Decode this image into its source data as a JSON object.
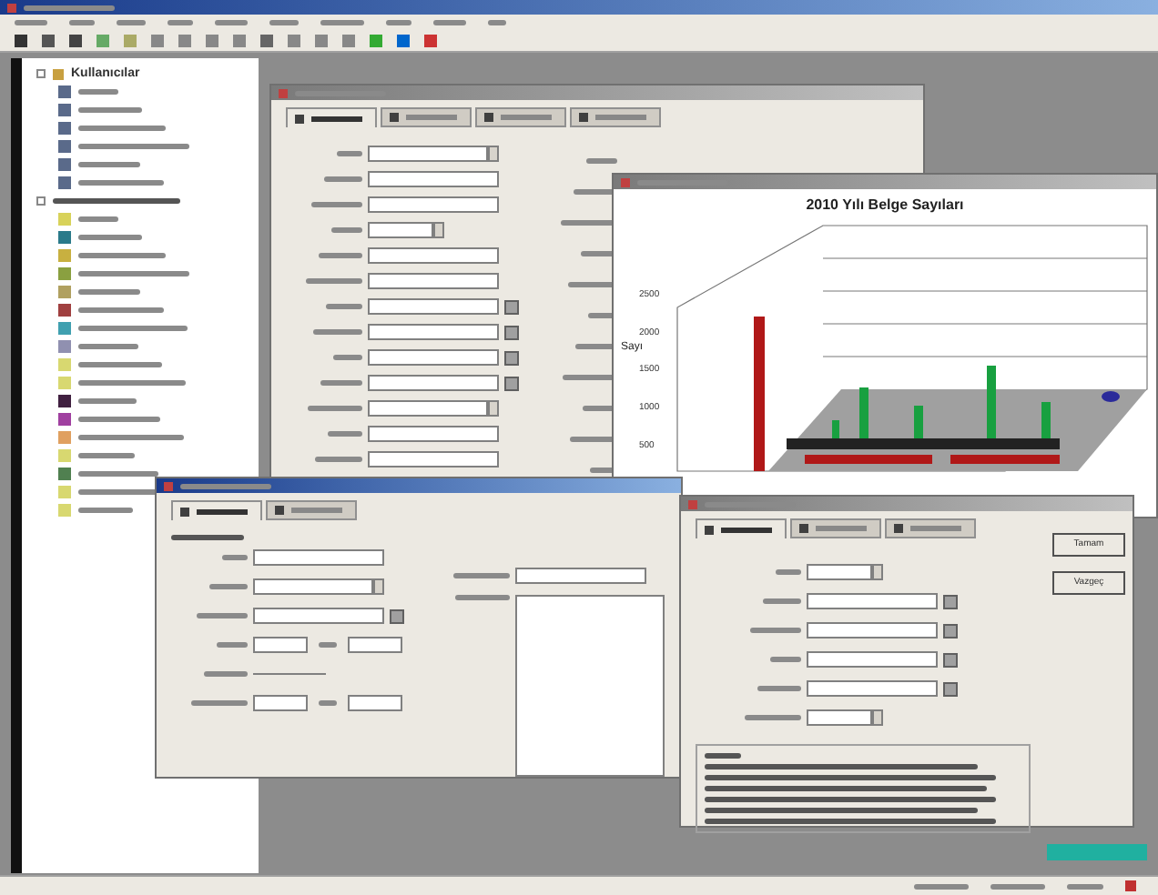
{
  "tree": {
    "heading": "Kullanıcılar",
    "groups": [
      {
        "items": [
          {
            "color": "#5a6a8a"
          },
          {
            "color": "#5a6a8a"
          },
          {
            "color": "#5a6a8a"
          },
          {
            "color": "#5a6a8a"
          },
          {
            "color": "#5a6a8a"
          },
          {
            "color": "#5a6a8a"
          }
        ]
      },
      {
        "items": [
          {
            "color": "#d8d25a"
          },
          {
            "color": "#2a7a8a"
          },
          {
            "color": "#c8b040"
          },
          {
            "color": "#8aa040"
          },
          {
            "color": "#b0a060"
          },
          {
            "color": "#a04040"
          },
          {
            "color": "#40a0b0"
          },
          {
            "color": "#9090b0"
          },
          {
            "color": "#d8d870"
          },
          {
            "color": "#d8d870"
          },
          {
            "color": "#402040"
          },
          {
            "color": "#a040a0"
          },
          {
            "color": "#e0a060"
          },
          {
            "color": "#d8d870"
          },
          {
            "color": "#508050"
          },
          {
            "color": "#d8d870"
          },
          {
            "color": "#d8d870"
          }
        ]
      }
    ]
  },
  "form_window": {
    "tabs": [
      {
        "selected": true
      },
      {
        "selected": false
      },
      {
        "selected": false
      },
      {
        "selected": false
      }
    ],
    "fields": [
      {
        "kind": "combo"
      },
      {
        "kind": "text"
      },
      {
        "kind": "text"
      },
      {
        "kind": "short"
      },
      {
        "kind": "text"
      },
      {
        "kind": "text"
      },
      {
        "kind": "pick"
      },
      {
        "kind": "pick"
      },
      {
        "kind": "pick"
      },
      {
        "kind": "pick"
      },
      {
        "kind": "combo"
      },
      {
        "kind": "text"
      },
      {
        "kind": "text"
      }
    ]
  },
  "chart_window": {
    "title": "2010 Yılı Belge Sayıları",
    "ylabel": "Sayı",
    "yticks": [
      "2500",
      "2000",
      "1500",
      "1000",
      "500"
    ]
  },
  "search_window": {
    "tabs": [
      {
        "selected": true
      },
      {
        "selected": false
      }
    ],
    "fields": [
      {
        "kind": "text"
      },
      {
        "kind": "combo"
      },
      {
        "kind": "pick"
      },
      {
        "kind": "pair"
      },
      {
        "kind": "line"
      },
      {
        "kind": "pair"
      }
    ]
  },
  "query_window": {
    "tabs": [
      {
        "selected": true
      },
      {
        "selected": false
      },
      {
        "selected": false
      }
    ],
    "fields": [
      {
        "kind": "short"
      },
      {
        "kind": "pick"
      },
      {
        "kind": "pick"
      },
      {
        "kind": "pick"
      },
      {
        "kind": "pick"
      },
      {
        "kind": "short"
      }
    ],
    "buttons": [
      "Tamam",
      "Vazgeç"
    ]
  }
}
